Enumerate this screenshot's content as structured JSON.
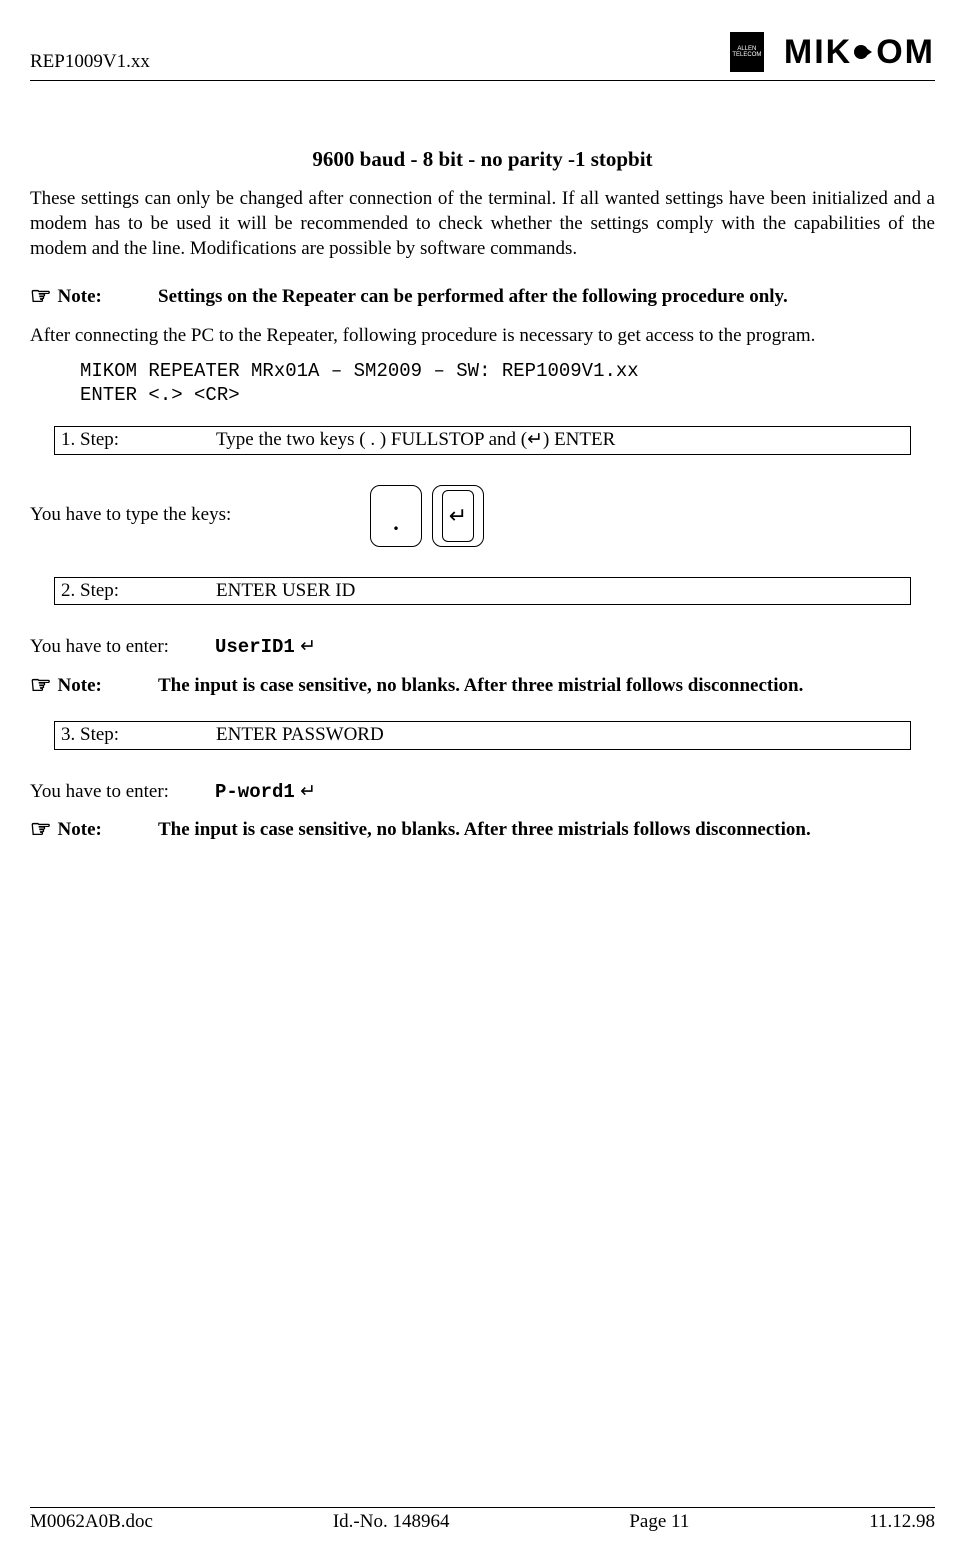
{
  "header": {
    "doc_ref": "REP1009V1.xx",
    "telecom_label": "ALLEN TELECOM",
    "brand": "MIKOM"
  },
  "title": "9600 baud - 8 bit - no parity -1 stopbit",
  "intro": "These settings can only be changed after connection of the terminal. If all wanted settings have been initialized and a modem has to be used it will be recommended to check whether the settings comply with the capabilities of the modem and the line. Modifications are possible by software commands.",
  "notes": {
    "label": "Note:",
    "n1": "Settings on the Repeater can be performed after the following procedure only.",
    "n2": "The input is case sensitive, no blanks. After three mistrial follows disconnection.",
    "n3": "The input is case sensitive, no blanks. After three mistrials follows disconnection."
  },
  "after_connecting": "After connecting the PC to the Repeater, following procedure is necessary to get access to the program.",
  "mono": "MIKOM REPEATER MRx01A – SM2009 – SW: REP1009V1.xx\nENTER <.> <CR>",
  "steps": {
    "s1": {
      "label": "1. Step:",
      "text": "Type the two keys ( . ) FULLSTOP and (↵) ENTER"
    },
    "s2": {
      "label": "2. Step:",
      "text": "ENTER USER ID"
    },
    "s3": {
      "label": "3. Step:",
      "text": "ENTER PASSWORD"
    }
  },
  "type_keys": "You have to type the keys:",
  "keys": {
    "period": ".",
    "enter": "↵"
  },
  "enter_label": "You have to enter:",
  "entries": {
    "userid": "UserID1",
    "password": "P-word1",
    "arrow": " ↵"
  },
  "footer": {
    "doc": "M0062A0B.doc",
    "id": "Id.-No. 148964",
    "page": "Page 11",
    "date": "11.12.98"
  }
}
